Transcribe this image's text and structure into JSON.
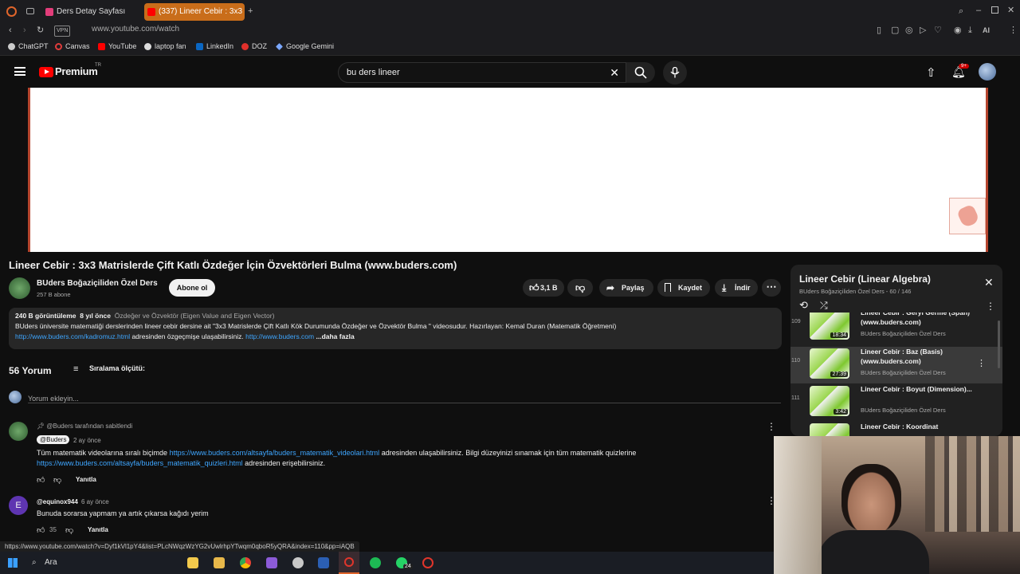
{
  "browser": {
    "tabs": [
      {
        "label": "Ders Detay Sayfası"
      },
      {
        "label": "(337) Lineer Cebir : 3x3 M"
      }
    ],
    "url": "www.youtube.com/watch",
    "vpn_label": "VPN",
    "ai_label": "AI",
    "bookmarks": [
      "ChatGPT",
      "Canvas",
      "YouTube",
      "laptop fan",
      "LinkedIn",
      "DOZ",
      "Google Gemini"
    ]
  },
  "youtube": {
    "logo_text": "Premium",
    "logo_region": "TR",
    "search_value": "bu ders lineer",
    "notification_count": "9+"
  },
  "video": {
    "title": "Lineer Cebir : 3x3 Matrislerde Çift Katlı Özdeğer İçin Özvektörleri Bulma (www.buders.com)",
    "channel_name": "BUders Boğaziçiliden Özel Ders",
    "subscribers": "257 B abone",
    "subscribe_label": "Abone ol",
    "likes": "3,1 B",
    "share_label": "Paylaş",
    "save_label": "Kaydet",
    "download_label": "İndir",
    "views": "240 B görüntüleme",
    "age": "8 yıl önce",
    "tags": "Özdeğer ve Özvektör (Eigen Value and Eigen Vector)",
    "desc_line1": "BUders üniversite matematiği derslerinden lineer cebir dersine  ait \"3x3 Matrislerde Çift Katlı Kök Durumunda Özdeğer ve Özvektör Bulma \" videosudur. Hazırlayan: Kemal Duran (Matematik Öğretmeni)",
    "desc_link1": "http://www.buders.com/kadromuz.html",
    "desc_mid": " adresinden özgeçmişe ulaşabilirsiniz. ",
    "desc_link2": "http://www.buders.com",
    "desc_more": " ...daha fazla"
  },
  "comments": {
    "count_label": "56 Yorum",
    "sort_label": "Sıralama ölçütü:",
    "add_placeholder": "Yorum ekleyin...",
    "items": [
      {
        "pinned_label": "@Buders tarafından sabitlendi",
        "author": "@Buders",
        "time": "2 ay önce",
        "text_a": "Tüm matematik videolarına sıralı biçimde ",
        "link_a": "https://www.buders.com/altsayfa/buders_matematik_videolari.html",
        "text_b": " adresinden ulaşabilirsiniz. Bilgi düzeyinizi sınamak için tüm matematik quizlerine",
        "link_b": "https://www.buders.com/altsayfa/buders_matematik_quizleri.html",
        "text_c": " adresinden erişebilirsiniz.",
        "reply_label": "Yanıtla"
      },
      {
        "avatar_letter": "E",
        "author": "@equinox944",
        "time": "6 ay önce",
        "text": "Bunuda sorarsa yapmam ya artık çıkarsa kağıdı yerim",
        "likes": "35",
        "reply_label": "Yanıtla"
      }
    ]
  },
  "playlist": {
    "title": "Lineer Cebir (Linear Algebra)",
    "subtitle": "BUders Boğaziçiliden Özel Ders - 60 / 146",
    "items": [
      {
        "num": "109",
        "title": "Lineer Cebir : Geryi Germe (Span) (www.buders.com)",
        "channel": "BUders Boğaziçiliden Özel Ders",
        "duration": "18:34"
      },
      {
        "num": "110",
        "title": "Lineer Cebir : Baz (Basis) (www.buders.com)",
        "channel": "BUders Boğaziçiliden Özel Ders",
        "duration": "27:39"
      },
      {
        "num": "111",
        "title": "Lineer Cebir : Boyut (Dimension)...",
        "channel": "BUders Boğaziçiliden Özel Ders",
        "duration": "3:42"
      },
      {
        "num": "",
        "title": "Lineer Cebir : Koordinat",
        "channel": "",
        "duration": ""
      }
    ]
  },
  "status_url": "https://www.youtube.com/watch?v=Dyf1kVl1pY4&list=PLcNWqzWzYG2vUwlrhpYTwqm0qboR5yQRA&index=110&pp=iAQB",
  "taskbar": {
    "search_label": "Ara",
    "whatsapp_badge": "24"
  },
  "colors": {
    "youtube_red": "#ff0000",
    "link": "#3ea6ff",
    "active_tab": "#c96d1a"
  }
}
